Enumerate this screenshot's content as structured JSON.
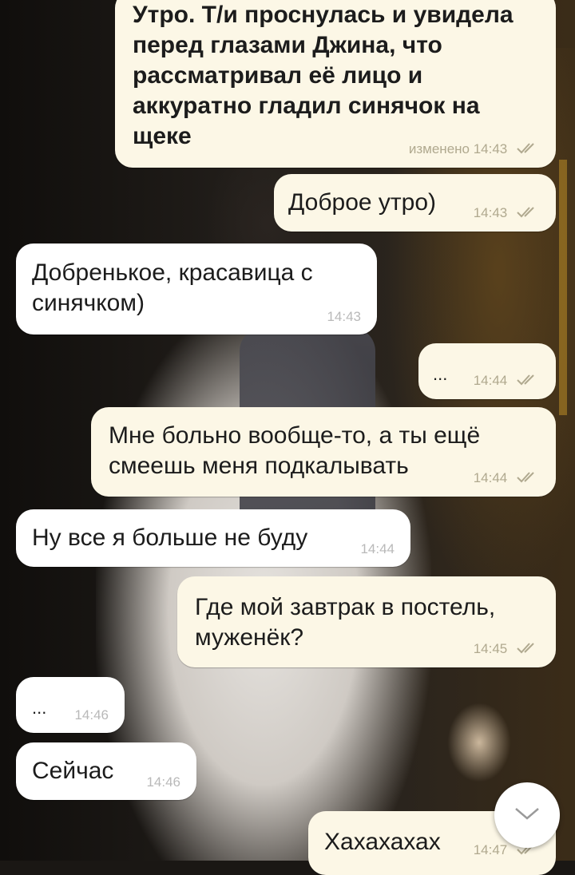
{
  "messages": [
    {
      "text": "Утро. Т/и проснулась и увидела перед глазами Джина, что рассматривал её лицо и аккуратно гладил синячок на щеке",
      "time": "изменено 14:43",
      "side": "out",
      "read": true
    },
    {
      "text": "Доброе утро)",
      "time": "14:43",
      "side": "out",
      "read": true
    },
    {
      "text": "Добренькое, красавица с синячком)",
      "time": "14:43",
      "side": "in"
    },
    {
      "text": "...",
      "time": "14:44",
      "side": "out",
      "read": true
    },
    {
      "text": "Мне больно вообще-то, а ты ещё смеешь меня подкалывать",
      "time": "14:44",
      "side": "out",
      "read": true
    },
    {
      "text": "Ну все я больше не буду",
      "time": "14:44",
      "side": "in"
    },
    {
      "text": "Где мой завтрак в постель, муженёк?",
      "time": "14:45",
      "side": "out",
      "read": true
    },
    {
      "text": "...",
      "time": "14:46",
      "side": "in"
    },
    {
      "text": "Сейчас",
      "time": "14:46",
      "side": "in"
    },
    {
      "text": "Хахахахах",
      "time": "14:47",
      "side": "out",
      "read": true
    }
  ],
  "colors": {
    "outgoing_bubble": "#fcf7e6",
    "incoming_bubble": "#ffffff",
    "read_check": "#b0a98f"
  },
  "icons": {
    "read_receipt": "double-check-icon",
    "scroll_down": "chevron-down-icon"
  }
}
